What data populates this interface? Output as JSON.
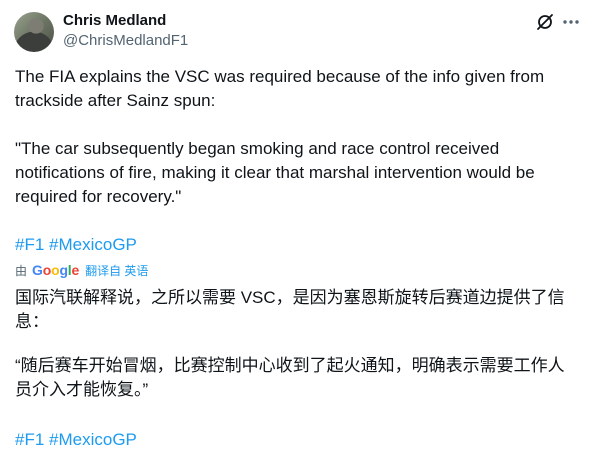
{
  "author": {
    "name": "Chris Medland",
    "handle": "@ChrisMedlandF1"
  },
  "tweet": {
    "paragraph1": "The FIA explains the VSC was required because of the info given from trackside after Sainz spun:",
    "paragraph2": "\"The car subsequently began smoking and race control received notifications of fire, making it clear that marshal intervention would be required for recovery.\"",
    "hashtags": [
      "#F1",
      "#MexicoGP"
    ]
  },
  "translation": {
    "by_label": "由",
    "provider": "Google",
    "provider_letters": [
      {
        "ch": "G",
        "color": "#4285F4"
      },
      {
        "ch": "o",
        "color": "#EA4335"
      },
      {
        "ch": "o",
        "color": "#FBBC05"
      },
      {
        "ch": "g",
        "color": "#4285F4"
      },
      {
        "ch": "l",
        "color": "#34A853"
      },
      {
        "ch": "e",
        "color": "#EA4335"
      }
    ],
    "link_label": "翻译自 英语",
    "paragraph1": "国际汽联解释说，之所以需要 VSC，是因为塞恩斯旋转后赛道边提供了信息：",
    "paragraph2": "“随后赛车开始冒烟，比赛控制中心收到了起火通知，明确表示需要工作人员介入才能恢复。”",
    "hashtags": [
      "#F1",
      "#MexicoGP"
    ]
  },
  "icons": {
    "grok": "grok-icon",
    "more": "more-icon"
  },
  "colors": {
    "text": "#0f1419",
    "secondary": "#536471",
    "link": "#1d9bf0"
  }
}
